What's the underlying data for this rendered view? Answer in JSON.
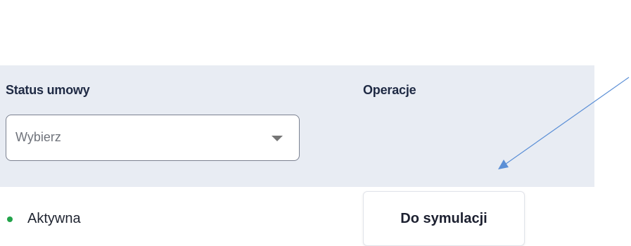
{
  "table": {
    "columns": {
      "status_label": "Status umowy",
      "operations_label": "Operacje"
    },
    "status_filter": {
      "selected_value": "Wybierz",
      "icon": "chevron-down-icon"
    },
    "row": {
      "status_text": "Aktywna",
      "status_color": "#22a34a",
      "action_label": "Do symulacji"
    }
  },
  "annotation": {
    "arrow_color": "#5b8fd6"
  },
  "colors": {
    "header_background": "#e8ecf3",
    "label_text": "#1f2a44"
  }
}
